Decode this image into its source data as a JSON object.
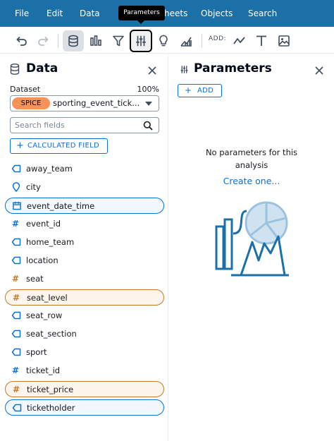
{
  "menu": {
    "file": "File",
    "edit": "Edit",
    "data": "Data",
    "sheets_partial": "heets",
    "objects": "Objects",
    "search": "Search"
  },
  "tooltip": "Parameters",
  "toolbar": {
    "icons": [
      "undo-icon",
      "redo-icon",
      "data-icon",
      "visualize-icon",
      "filter-icon",
      "parameters-icon",
      "insights-icon",
      "forecast-icon",
      "line-visual-icon",
      "text-box-icon",
      "image-icon"
    ],
    "add_label": "ADD:"
  },
  "data_panel": {
    "title": "Data",
    "dataset_label": "Dataset",
    "dataset_percent": "100%",
    "spice_badge": "SPICE",
    "dataset_name": "sporting_event_ticket_info",
    "search_placeholder": "Search fields",
    "calculated_field_label": "CALCULATED FIELD",
    "fields": [
      {
        "name": "away_team",
        "type": "dimension"
      },
      {
        "name": "city",
        "type": "geo"
      },
      {
        "name": "event_date_time",
        "type": "date"
      },
      {
        "name": "event_id",
        "type": "measure-id"
      },
      {
        "name": "home_team",
        "type": "dimension"
      },
      {
        "name": "location",
        "type": "dimension"
      },
      {
        "name": "seat",
        "type": "measure"
      },
      {
        "name": "seat_level",
        "type": "measure"
      },
      {
        "name": "seat_row",
        "type": "dimension"
      },
      {
        "name": "seat_section",
        "type": "dimension"
      },
      {
        "name": "sport",
        "type": "dimension"
      },
      {
        "name": "ticket_id",
        "type": "measure-id"
      },
      {
        "name": "ticket_price",
        "type": "measure"
      },
      {
        "name": "ticketholder",
        "type": "dimension"
      }
    ]
  },
  "params_panel": {
    "title": "Parameters",
    "add_label": "ADD",
    "empty_message": "No parameters for this analysis",
    "create_link": "Create one..."
  },
  "colors": {
    "menubar": "#1b70a8",
    "accent": "#0972d3",
    "spice": "#f89256",
    "measure": "#c27a2c",
    "dimension": "#0972d3",
    "illustration": "#1b70a8"
  }
}
